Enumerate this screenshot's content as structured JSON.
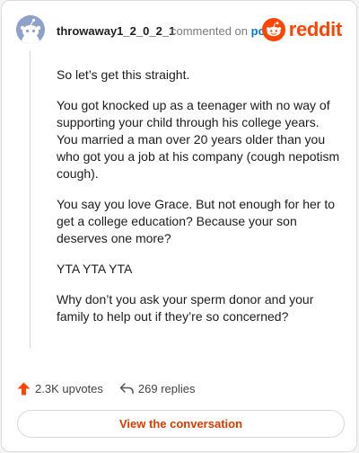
{
  "comment": {
    "username": "throwaway1_2_0_2_1",
    "meta_prefix": "commented on",
    "meta_link": "post",
    "brand": "reddit",
    "paragraphs": [
      "So let’s get this straight.",
      "You got knocked up as a teenager with no way of supporting your child through his college years. You married a man over 20 years older than you who got you a job at his company (cough nepotism cough).",
      "You say you love Grace. But not enough for her to get a college education? Because your son deserves one more?",
      "YTA YTA YTA",
      "Why don’t you ask your sperm donor and your family to help out if they’re so concerned?"
    ]
  },
  "actions": {
    "upvotes": "2.3K upvotes",
    "replies": "269 replies"
  },
  "footer": {
    "view_label": "View the conversation"
  },
  "colors": {
    "brand": "#ff4500",
    "link": "#0079d3",
    "view_button_text": "#d93a00",
    "avatar_bg": "#8fa0c9"
  },
  "icons": {
    "avatar": "snoo-avatar-icon",
    "logo": "reddit-logo-icon",
    "upvote": "upvote-arrow-icon",
    "reply": "reply-arrow-icon"
  }
}
